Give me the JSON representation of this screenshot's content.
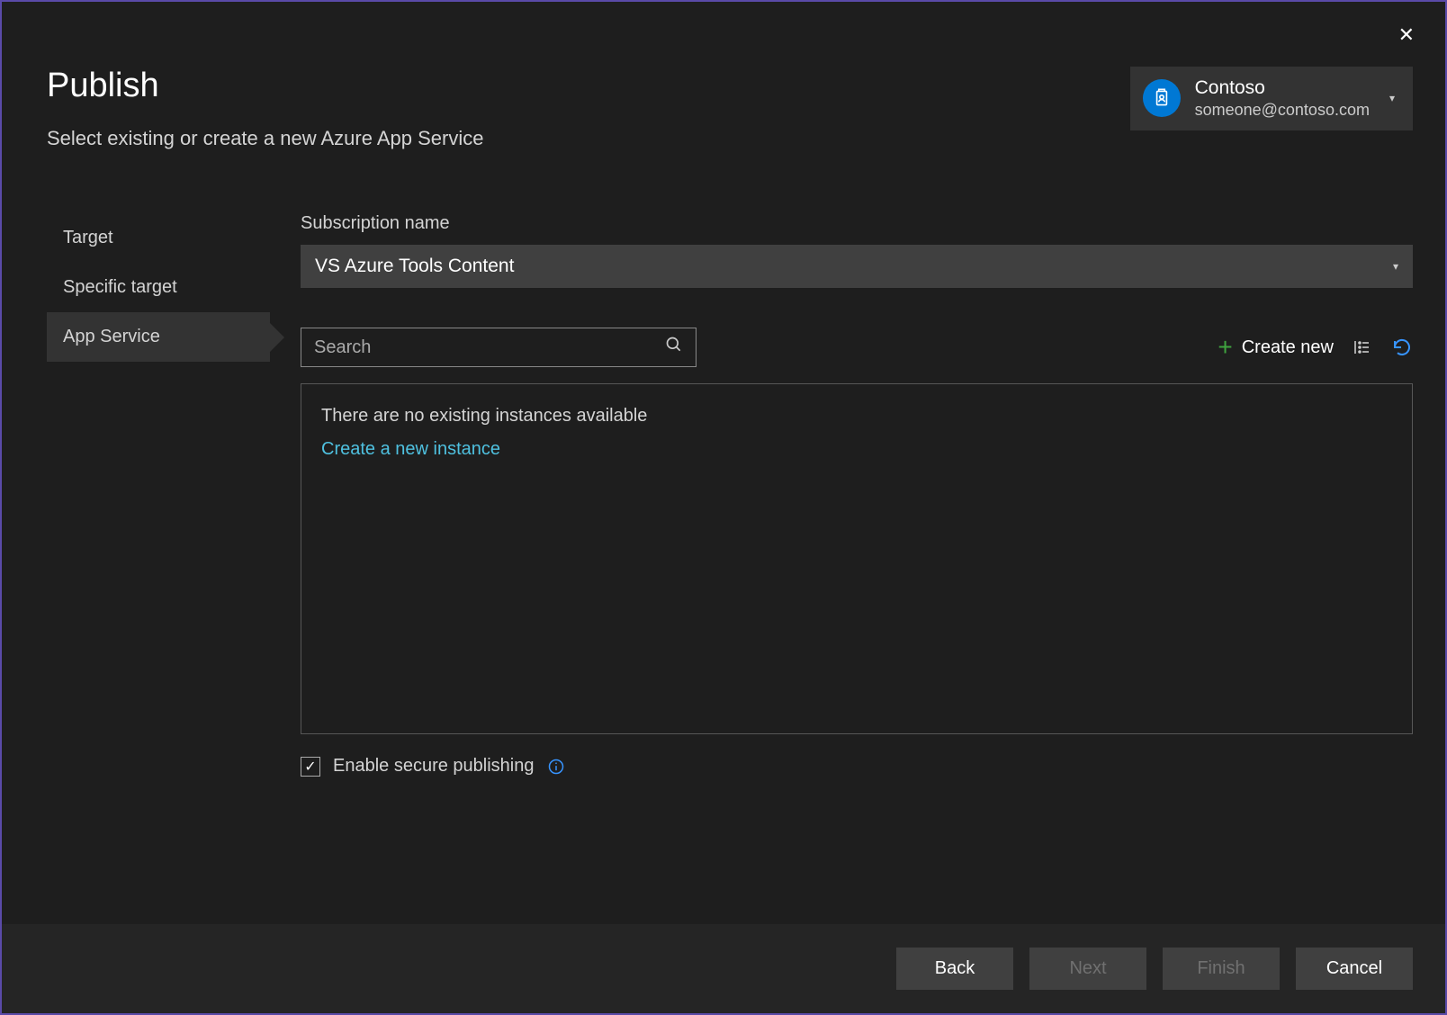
{
  "close_label": "✕",
  "account": {
    "name": "Contoso",
    "email": "someone@contoso.com"
  },
  "header": {
    "title": "Publish",
    "subtitle": "Select existing or create a new Azure App Service"
  },
  "sidebar": {
    "items": [
      {
        "label": "Target"
      },
      {
        "label": "Specific target"
      },
      {
        "label": "App Service"
      }
    ]
  },
  "main": {
    "subscription_label": "Subscription name",
    "subscription_value": "VS Azure Tools Content",
    "search_placeholder": "Search",
    "create_new_label": "Create new",
    "empty_message": "There are no existing instances available",
    "create_instance_link": "Create a new instance",
    "secure_publishing_label": "Enable secure publishing"
  },
  "footer": {
    "back": "Back",
    "next": "Next",
    "finish": "Finish",
    "cancel": "Cancel"
  }
}
